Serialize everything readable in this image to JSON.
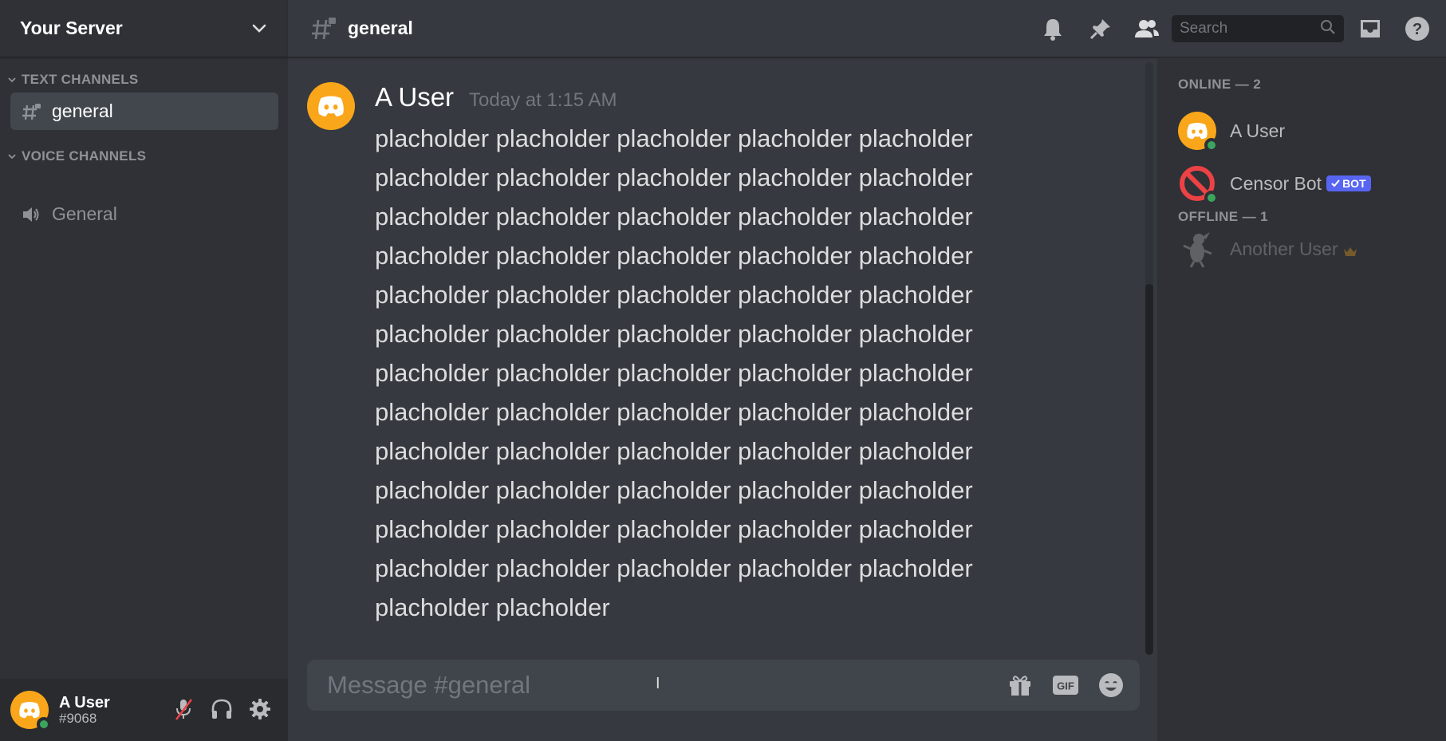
{
  "server": {
    "name": "Your Server"
  },
  "sidebar": {
    "categories": [
      {
        "label": "TEXT CHANNELS"
      },
      {
        "label": "VOICE CHANNELS"
      }
    ],
    "channels": [
      {
        "name": "general",
        "type": "text",
        "active": true
      },
      {
        "name": "General",
        "type": "voice",
        "active": false
      }
    ]
  },
  "user": {
    "name": "A User",
    "tag": "#9068"
  },
  "channel": {
    "name": "general"
  },
  "search": {
    "placeholder": "Search"
  },
  "message": {
    "author": "A User",
    "timestamp": "Today at 1:15 AM",
    "text": "placholder placholder placholder placholder placholder placholder placholder placholder placholder placholder placholder placholder placholder placholder placholder placholder placholder placholder placholder placholder placholder placholder placholder placholder placholder placholder placholder placholder placholder placholder placholder placholder placholder placholder placholder placholder placholder placholder placholder placholder placholder placholder placholder placholder placholder placholder placholder placholder placholder placholder placholder placholder placholder placholder placholder placholder placholder placholder placholder placholder placholder placholder"
  },
  "composer": {
    "placeholder": "Message #general"
  },
  "members": {
    "online_label": "ONLINE — 2",
    "offline_label": "OFFLINE — 1",
    "online": [
      {
        "name": "A User",
        "status": "online"
      },
      {
        "name": "Censor Bot",
        "status": "online",
        "badge": "BOT"
      }
    ],
    "offline": [
      {
        "name": "Another User",
        "owner": true
      }
    ]
  },
  "colors": {
    "accent": "#5865f2",
    "online": "#3ba55d",
    "avatar": "#faa61a",
    "bot_avatar": "#ed4245",
    "crown": "#faa61a"
  },
  "icons": [
    "chevron-down-icon",
    "hashtag-lock-icon",
    "speaker-icon",
    "bell-icon",
    "pin-icon",
    "members-icon",
    "search-icon",
    "inbox-icon",
    "help-icon",
    "mic-muted-icon",
    "headphones-icon",
    "gear-icon",
    "gift-icon",
    "gif-icon",
    "emoji-icon",
    "crown-icon",
    "check-icon"
  ]
}
